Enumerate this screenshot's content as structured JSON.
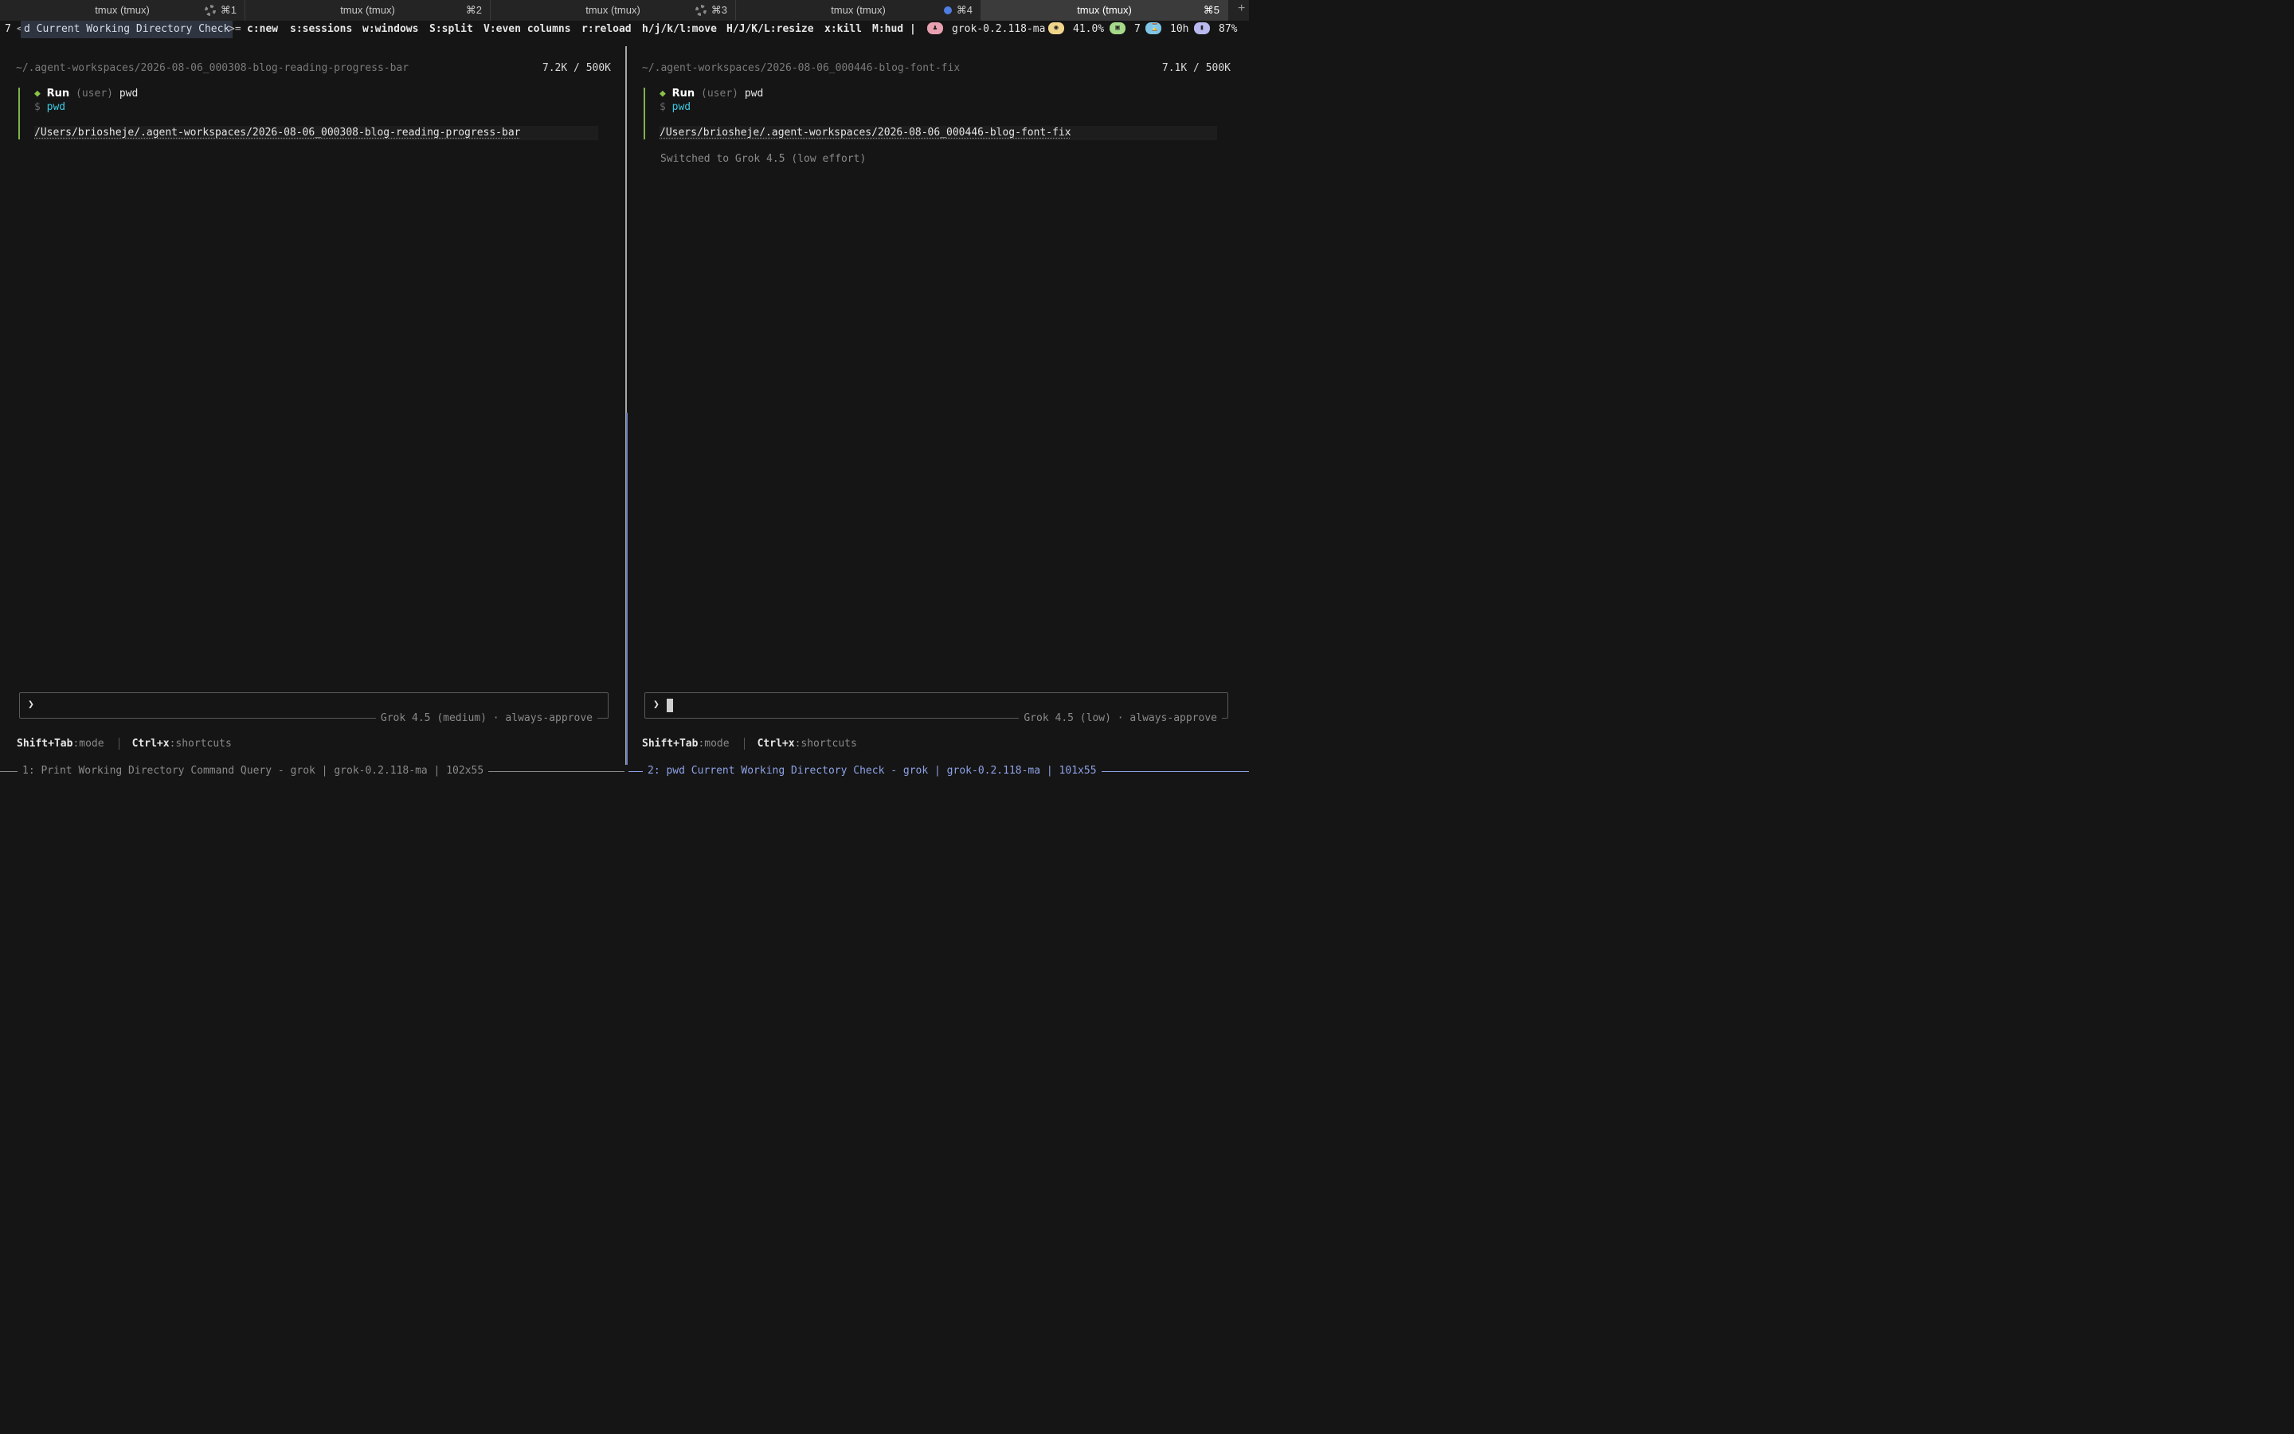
{
  "tabs": [
    {
      "title": "tmux (tmux)",
      "shortcut": "⌘1",
      "indicator": "spinner"
    },
    {
      "title": "tmux (tmux)",
      "shortcut": "⌘2",
      "indicator": "none"
    },
    {
      "title": "tmux (tmux)",
      "shortcut": "⌘3",
      "indicator": "spinner"
    },
    {
      "title": "tmux (tmux)",
      "shortcut": "⌘4",
      "indicator": "blue-dot"
    },
    {
      "title": "tmux (tmux)",
      "shortcut": "⌘5",
      "indicator": "none",
      "active": true
    }
  ],
  "new_tab_label": "+",
  "status": {
    "session_number": "7",
    "session_prefix": "<",
    "session_name": "d Current Working Directory Check ",
    "session_suffix": ">=",
    "keys": [
      "c:new",
      "s:sessions",
      "w:windows",
      "S:split",
      "V:even columns",
      "r:reload",
      "h/j/k/l:move",
      "H/J/K/L:resize",
      "x:kill",
      "M:hud",
      "|"
    ],
    "model": "grok-0.2.118-ma",
    "cpu": "41.0%",
    "windows": "7",
    "uptime": "10h",
    "battery": "87%",
    "badge_colors": {
      "model": "#e8a0b0",
      "cpu": "#f0d58a",
      "windows": "#a6d98a",
      "uptime": "#7fc6e6",
      "battery": "#b9b9f0"
    }
  },
  "panes": {
    "left": {
      "workspace_path": "~/.agent-workspaces/2026-08-06_000308-blog-reading-progress-bar",
      "tokens": "7.2K / 500K",
      "run_label": "Run",
      "run_user": "(user)",
      "run_cmd": "pwd",
      "prompt_symbol": "$",
      "prompt_cmd": "pwd",
      "output": "/Users/briosheje/.agent-workspaces/2026-08-06_000308-blog-reading-progress-bar",
      "input_chevron": "❯",
      "model_label": "Grok 4.5 (medium) · always-approve",
      "hint_mode_key": "Shift+Tab",
      "hint_mode_text": ":mode",
      "hint_shortcut_key": "Ctrl+x",
      "hint_shortcut_text": ":shortcuts",
      "bottom_title": "1: Print Working Directory Command Query - grok | grok-0.2.118-ma | 102x55"
    },
    "right": {
      "workspace_path": "~/.agent-workspaces/2026-08-06_000446-blog-font-fix",
      "tokens": "7.1K / 500K",
      "run_label": "Run",
      "run_user": "(user)",
      "run_cmd": "pwd",
      "prompt_symbol": "$",
      "prompt_cmd": "pwd",
      "output": "/Users/briosheje/.agent-workspaces/2026-08-06_000446-blog-font-fix",
      "notice": "Switched to Grok 4.5 (low effort)",
      "input_chevron": "❯",
      "model_label": "Grok 4.5 (low) · always-approve",
      "hint_mode_key": "Shift+Tab",
      "hint_mode_text": ":mode",
      "hint_shortcut_key": "Ctrl+x",
      "hint_shortcut_text": ":shortcuts",
      "bottom_title": "2: pwd Current Working Directory Check - grok | grok-0.2.118-ma | 101x55"
    }
  },
  "colors": {
    "background": "#151515",
    "accent_green": "#7fb34a",
    "accent_cyan": "#3cc7e0",
    "active_pane_border": "#8ea2e6"
  }
}
